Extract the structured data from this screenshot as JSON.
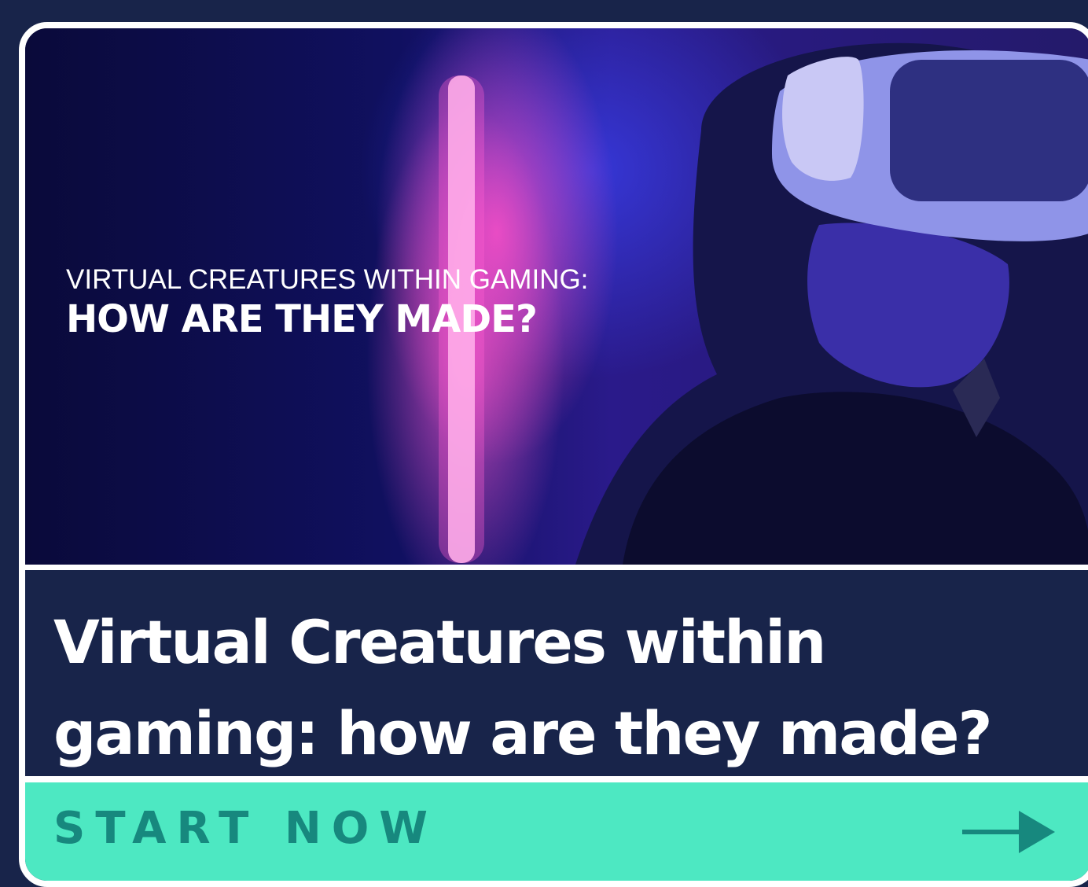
{
  "hero": {
    "overline": "VIRTUAL CREATURES WITHIN GAMING:",
    "headline": "HOW ARE THEY MADE?"
  },
  "card": {
    "title": "Virtual Creatures within gaming: how are they made?"
  },
  "cta": {
    "label": "START NOW",
    "icon": "arrow-right-icon"
  },
  "colors": {
    "background": "#18244a",
    "cta_background": "#4de8c2",
    "cta_text": "#17887e",
    "border": "#ffffff"
  }
}
